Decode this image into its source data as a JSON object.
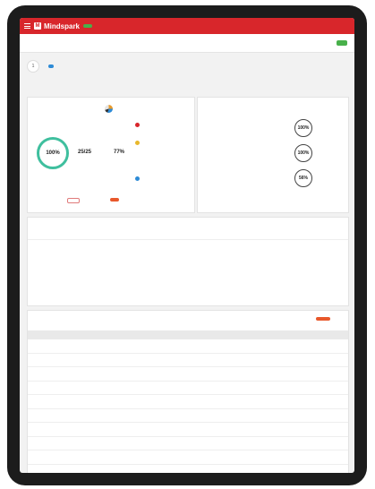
{
  "nav": {
    "brand": "Mindspark",
    "badge": "",
    "links": [
      "",
      "",
      "",
      "",
      ""
    ]
  },
  "subnav": {
    "tabs": [
      "",
      "",
      "",
      ""
    ],
    "action": ""
  },
  "filter": {
    "step": "1",
    "label": "",
    "chip": "",
    "colors": {
      "primary": "#d8262b",
      "green": "#48b04a",
      "blue": "#2d8bd6",
      "orange": "#e8582b"
    }
  },
  "summary": {
    "title": "",
    "subtitle": "",
    "progress_label": "",
    "ring_value": "100%",
    "ring_caption": "",
    "stat1": "25/25",
    "stat1_caption": "",
    "stat2": "77%",
    "stat2_caption": "",
    "legend": [
      "",
      "",
      ""
    ],
    "btn_outline": "",
    "btn_primary": ""
  },
  "other_topics": {
    "heading": "",
    "topics": [
      {
        "name": "",
        "desc": "",
        "value": "100%",
        "caption": ""
      },
      {
        "name": "",
        "desc": "",
        "value": "100%",
        "caption": ""
      },
      {
        "name": "",
        "desc": "",
        "value": "56%",
        "caption": ""
      }
    ]
  },
  "overview": {
    "heading": "",
    "col1": "",
    "col2": "",
    "items": [
      {
        "name": "",
        "desc": ""
      },
      {
        "name": "",
        "desc": ""
      },
      {
        "name": "",
        "desc": ""
      },
      {
        "name": "",
        "desc": ""
      }
    ]
  },
  "performance": {
    "heading": "",
    "button": "",
    "columns": [
      "",
      "",
      "",
      "",
      "",
      "",
      ""
    ],
    "rows": [
      {
        "n": "",
        "name": "",
        "c1": "",
        "c2": "",
        "c3": "",
        "c4": ""
      },
      {
        "n": "",
        "name": "",
        "c1": "",
        "c2": "",
        "c3": "",
        "c4": ""
      },
      {
        "n": "",
        "name": "",
        "c1": "",
        "c2": "",
        "c3": "",
        "c4": ""
      },
      {
        "n": "",
        "name": "",
        "c1": "",
        "c2": "",
        "c3": "",
        "c4": ""
      },
      {
        "n": "",
        "name": "",
        "c1": "",
        "c2": "",
        "c3": "",
        "c4": ""
      },
      {
        "n": "",
        "name": "",
        "c1": "",
        "c2": "",
        "c3": "",
        "c4": ""
      },
      {
        "n": "",
        "name": "",
        "c1": "",
        "c2": "",
        "c3": "",
        "c4": ""
      },
      {
        "n": "",
        "name": "",
        "c1": "",
        "c2": "",
        "c3": "",
        "c4": ""
      },
      {
        "n": "",
        "name": "",
        "c1": "",
        "c2": "",
        "c3": "",
        "c4": ""
      }
    ]
  }
}
